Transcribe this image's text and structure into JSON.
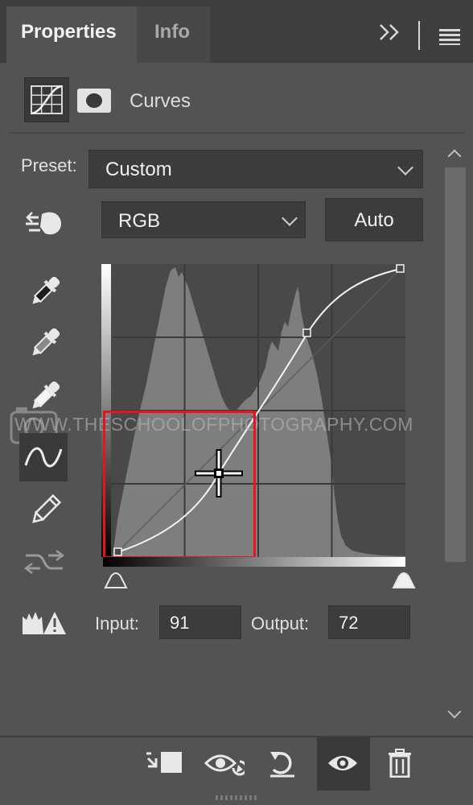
{
  "tabs": [
    {
      "label": "Properties",
      "active": true
    },
    {
      "label": "Info",
      "active": false
    }
  ],
  "header": {
    "adjustment_label": "Curves"
  },
  "preset": {
    "label": "Preset:",
    "value": "Custom"
  },
  "channel": {
    "value": "RGB"
  },
  "auto_button": {
    "label": "Auto"
  },
  "watermark": "WWW.THESCHOOLOFPHOTOGRAPHY.COM",
  "input": {
    "label": "Input:",
    "value": "91"
  },
  "output": {
    "label": "Output:",
    "value": "72"
  },
  "icons": {
    "tab_menu": [
      "collapse-panel-icon",
      "panel-menu-icon"
    ],
    "header": [
      "curves-adjustment-icon",
      "layer-mask-icon"
    ],
    "tools": [
      "on-image-adjust-icon",
      "black-point-eyedropper-icon",
      "gray-point-eyedropper-icon",
      "white-point-eyedropper-icon",
      "curve-edit-icon",
      "pencil-icon",
      "smooth-curve-icon",
      "clipping-warning-icon"
    ],
    "bottom": [
      "clip-to-layer-icon",
      "view-previous-state-icon",
      "reset-icon",
      "visibility-eye-icon",
      "delete-icon"
    ]
  },
  "colors": {
    "panel_bg": "#535353",
    "highlight": "#e8141c"
  }
}
